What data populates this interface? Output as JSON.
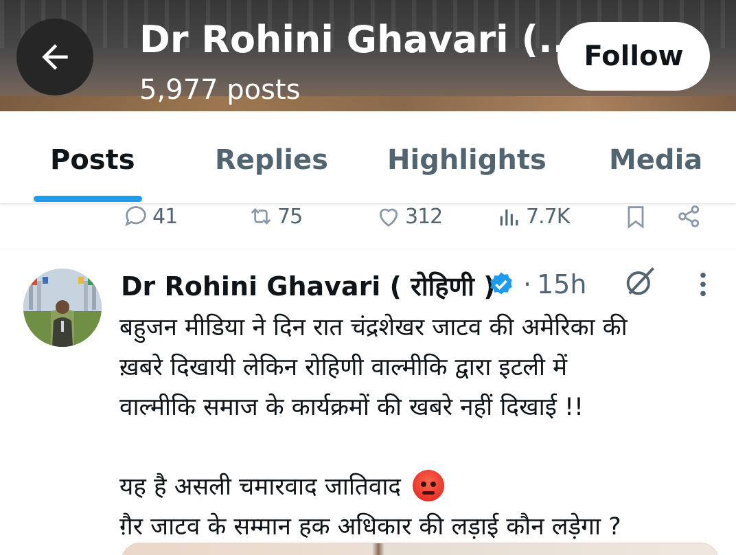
{
  "header": {
    "title": "Dr Rohini Ghavari (...",
    "posts_count": "5,977 posts",
    "follow_label": "Follow"
  },
  "tabs": [
    {
      "label": "Posts",
      "active": true
    },
    {
      "label": "Replies",
      "active": false
    },
    {
      "label": "Highlights",
      "active": false
    },
    {
      "label": "Media",
      "active": false
    }
  ],
  "prev_post_actions": {
    "replies": "41",
    "reposts": "75",
    "likes": "312",
    "views": "7.7K"
  },
  "post": {
    "author_name": "Dr Rohini Ghavari ( रोहिणी )",
    "verified": true,
    "separator": "·",
    "time": "15h",
    "lines": [
      "बहुजन मीडिया ने दिन रात चंद्रशेखर जाटव की अमेरिका की",
      "ख़बरे दिखायी लेकिन रोहिणी वाल्मीकि द्वारा इटली में",
      "वाल्मीकि समाज के कार्यक्रमों की खबरे नहीं दिखाई !!",
      "यह है असली चमारवाद जातिवाद",
      "ग़ैर जाटव के सम्मान हक अधिकार की लड़ाई कौन लड़ेगा ?"
    ],
    "emoji": "angry-face"
  },
  "colors": {
    "accent": "#1d9bf0",
    "text_primary": "#0f1419",
    "text_secondary": "#536471",
    "verified": "#1d9bf0"
  },
  "icons": {
    "back": "arrow-left-icon",
    "reply": "reply-icon",
    "repost": "repost-icon",
    "like": "heart-icon",
    "views": "views-icon",
    "bookmark": "bookmark-icon",
    "share": "share-icon",
    "grok": "grok-icon",
    "more": "more-vertical-icon",
    "verified": "verified-badge-icon"
  }
}
